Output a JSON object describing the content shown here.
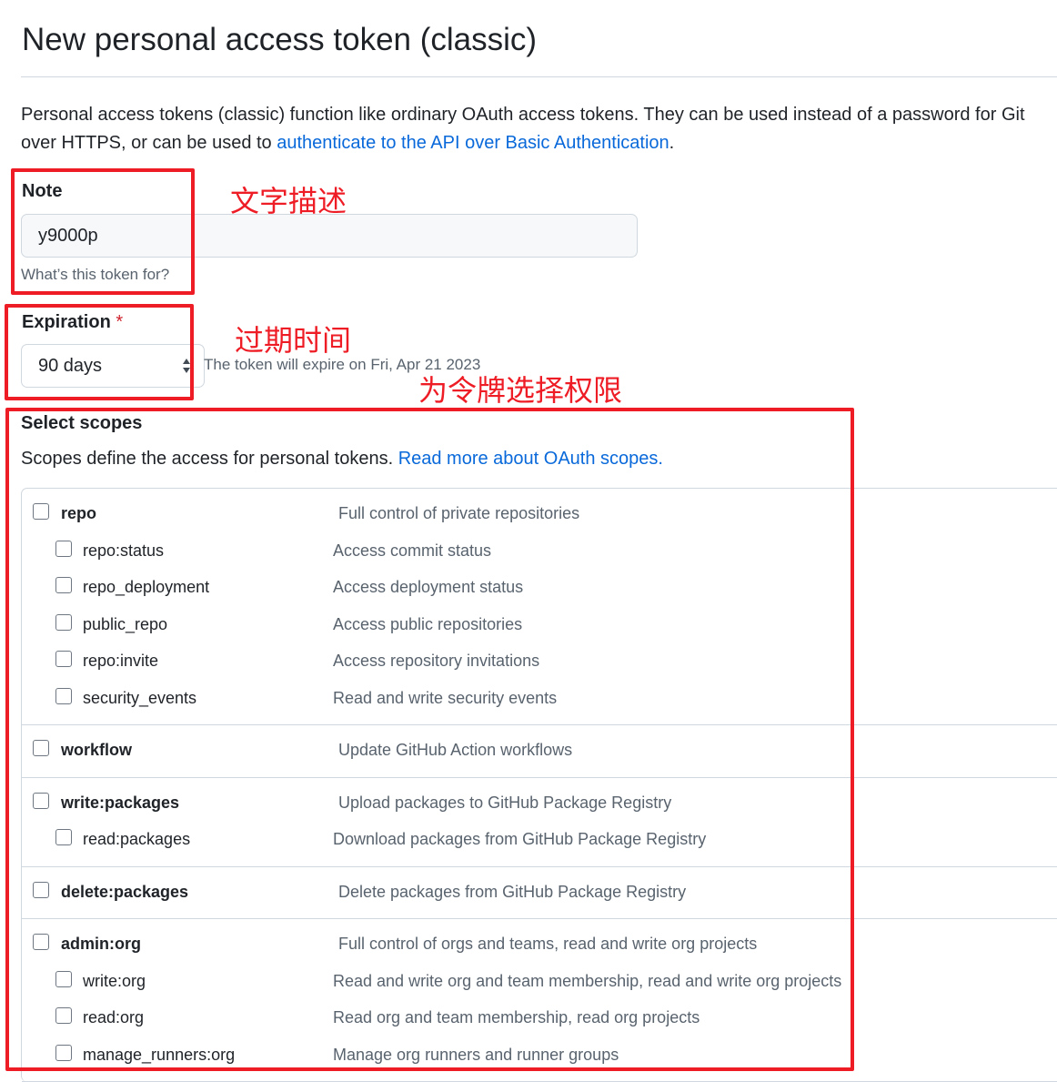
{
  "page_title": "New personal access token (classic)",
  "intro": {
    "text": "Personal access tokens (classic) function like ordinary OAuth access tokens. They can be used instead of a password for Git over HTTPS, or can be used to ",
    "link": "authenticate to the API over Basic Authentication",
    "end": "."
  },
  "note": {
    "label": "Note",
    "value": "y9000p",
    "hint": "What’s this token for?"
  },
  "expiration": {
    "label": "Expiration",
    "required_mark": "*",
    "selected": "90 days",
    "hint": "The token will expire on Fri, Apr 21 2023"
  },
  "scopes": {
    "title": "Select scopes",
    "description": "Scopes define the access for personal tokens. ",
    "link": "Read more about OAuth scopes.",
    "groups": [
      {
        "name": "repo",
        "desc": "Full control of private repositories",
        "children": [
          {
            "name": "repo:status",
            "desc": "Access commit status"
          },
          {
            "name": "repo_deployment",
            "desc": "Access deployment status"
          },
          {
            "name": "public_repo",
            "desc": "Access public repositories"
          },
          {
            "name": "repo:invite",
            "desc": "Access repository invitations"
          },
          {
            "name": "security_events",
            "desc": "Read and write security events"
          }
        ]
      },
      {
        "name": "workflow",
        "desc": "Update GitHub Action workflows",
        "children": []
      },
      {
        "name": "write:packages",
        "desc": "Upload packages to GitHub Package Registry",
        "children": [
          {
            "name": "read:packages",
            "desc": "Download packages from GitHub Package Registry"
          }
        ]
      },
      {
        "name": "delete:packages",
        "desc": "Delete packages from GitHub Package Registry",
        "children": []
      },
      {
        "name": "admin:org",
        "desc": "Full control of orgs and teams, read and write org projects",
        "children": [
          {
            "name": "write:org",
            "desc": "Read and write org and team membership, read and write org projects"
          },
          {
            "name": "read:org",
            "desc": "Read org and team membership, read org projects"
          },
          {
            "name": "manage_runners:org",
            "desc": "Manage org runners and runner groups"
          }
        ]
      }
    ]
  },
  "annotations": {
    "note": "文字描述",
    "expiration": "过期时间",
    "scopes": "为令牌选择权限"
  },
  "colors": {
    "link": "#0969da",
    "annotation": "#ee1c25",
    "required": "#cf222e"
  }
}
